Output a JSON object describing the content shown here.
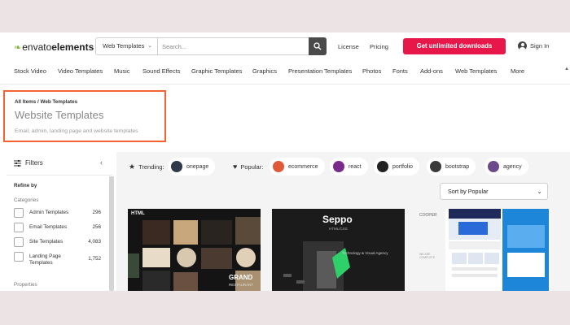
{
  "header": {
    "logo_text": "envato",
    "logo_bold": "elements",
    "search_category": "Web Templates",
    "search_placeholder": "Search...",
    "license_label": "License",
    "pricing_label": "Pricing",
    "cta_label": "Get unlimited downloads",
    "signin_label": "Sign In"
  },
  "nav": {
    "items": [
      "Stock Video",
      "Video Templates",
      "Music",
      "Sound Effects",
      "Graphic Templates",
      "Graphics",
      "Presentation Templates",
      "Photos",
      "Fonts",
      "Add-ons",
      "Web Templates",
      "More"
    ]
  },
  "page": {
    "breadcrumb": "All Items / Web Templates",
    "title": "Website Templates",
    "subtitle": "Email, admin, landing page and website templates"
  },
  "sidebar": {
    "filters_label": "Filters",
    "refine_label": "Refine by",
    "categories_label": "Categories",
    "categories": [
      {
        "label": "Admin Templates",
        "count": "296"
      },
      {
        "label": "Email Templates",
        "count": "256"
      },
      {
        "label": "Site Templates",
        "count": "4,083"
      },
      {
        "label": "Landing Page Templates",
        "count": "1,752"
      }
    ],
    "properties_label": "Properties"
  },
  "main": {
    "trending_label": "Trending:",
    "popular_label": "Popular:",
    "trending": [
      {
        "label": "onepage"
      }
    ],
    "popular": [
      {
        "label": "ecommerce"
      },
      {
        "label": "react"
      },
      {
        "label": "portfolio"
      },
      {
        "label": "bootstrap"
      },
      {
        "label": "agency"
      }
    ],
    "sort_label": "Sort by Popular",
    "cards": [
      {
        "tag": "HTML",
        "brand": "GRAND",
        "brand_sub": "RESTAURANT"
      },
      {
        "brand": "Seppo",
        "tag": "HTML/CSS",
        "headline": "Technology & Visual Agency"
      },
      {
        "brand": "COOPER",
        "tagline": "WE ARE COMPLETE"
      }
    ]
  },
  "colors": {
    "accent": "#e7174a",
    "highlight": "#f26232",
    "leaf": "#82b541"
  }
}
